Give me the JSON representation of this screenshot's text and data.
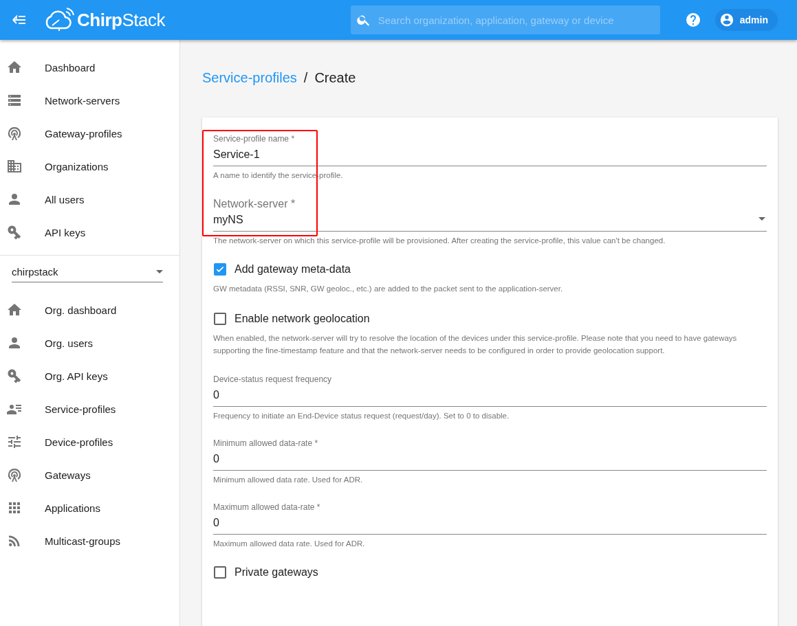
{
  "header": {
    "brand": "**Chirp**Stack",
    "search": {
      "placeholder": "Search organization, application, gateway or device"
    },
    "user": "admin"
  },
  "sidebar": {
    "items": [
      {
        "label": "Dashboard",
        "selected": false
      },
      {
        "label": "Network-servers",
        "selected": false
      },
      {
        "label": "Gateway-profiles",
        "selected": false
      },
      {
        "label": "Organizations",
        "selected": false
      },
      {
        "label": "All users",
        "selected": false
      },
      {
        "label": "API keys",
        "selected": false
      }
    ],
    "organization_select": {
      "value": "chirpstack"
    },
    "org_items": [
      {
        "label": "Org. dashboard",
        "selected": false
      },
      {
        "label": "Org. users",
        "selected": false
      },
      {
        "label": "Org. API keys",
        "selected": false
      },
      {
        "label": "Service-profiles",
        "selected": false
      },
      {
        "label": "Device-profiles",
        "selected": false
      },
      {
        "label": "Gateways",
        "selected": false
      },
      {
        "label": "Applications",
        "selected": false
      },
      {
        "label": "Multicast-groups",
        "selected": false
      }
    ]
  },
  "breadcrumb": {
    "link": "Service-profiles",
    "separator": "/",
    "current": "Create"
  },
  "form": {
    "annotation_frame": true,
    "fields": [
      {
        "kind": "text",
        "label": "Service-profile name *",
        "value": "Service-1",
        "helper": "A name to identify the service-profile."
      },
      {
        "kind": "select",
        "label": "Network-server *",
        "value": "myNS",
        "helper": "The network-server on which this service-profile will be provisioned. After creating the service-profile, this value can't be changed."
      },
      {
        "kind": "checkbox",
        "label": "Add gateway meta-data",
        "checked": true,
        "helper": "GW metadata (RSSI, SNR, GW geoloc., etc.) are added to the packet sent to the application-server."
      },
      {
        "kind": "checkbox",
        "label": "Enable network geolocation",
        "checked": false,
        "helper": "When enabled, the network-server will try to resolve the location of the devices under this service-profile. Please note that you need to have gateways supporting the fine-timestamp feature and that the network-server needs to be configured in order to provide geolocation support."
      },
      {
        "kind": "text",
        "label": "Device-status request frequency",
        "value": "0",
        "helper": "Frequency to initiate an End-Device status request (request/day). Set to 0 to disable."
      },
      {
        "kind": "text",
        "label": "Minimum allowed data-rate *",
        "value": "0",
        "helper": "Minimum allowed data rate. Used for ADR."
      },
      {
        "kind": "text",
        "label": "Maximum allowed data-rate *",
        "value": "0",
        "helper": "Maximum allowed data rate. Used for ADR."
      },
      {
        "kind": "checkbox",
        "label": "Private gateways",
        "checked": false
      }
    ]
  }
}
